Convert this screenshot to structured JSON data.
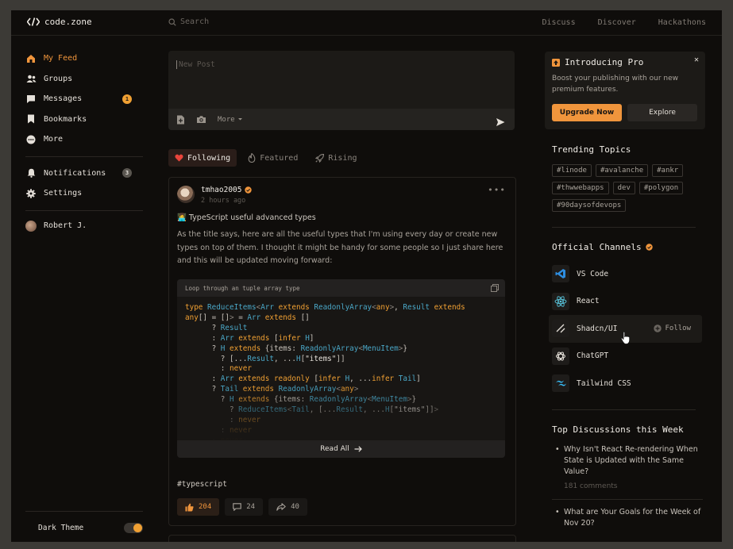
{
  "header": {
    "logo_text": "code.zone",
    "search_placeholder": "Search",
    "nav": [
      "Discuss",
      "Discover",
      "Hackathons"
    ]
  },
  "sidebar": {
    "items": [
      {
        "label": "My Feed",
        "icon": "home-icon",
        "active": true
      },
      {
        "label": "Groups",
        "icon": "groups-icon"
      },
      {
        "label": "Messages",
        "icon": "messages-icon",
        "badge": "1"
      },
      {
        "label": "Bookmarks",
        "icon": "bookmark-icon"
      },
      {
        "label": "More",
        "icon": "more-icon"
      }
    ],
    "secondary": [
      {
        "label": "Notifications",
        "icon": "bell-icon",
        "badge": "3"
      },
      {
        "label": "Settings",
        "icon": "gear-icon"
      }
    ],
    "profile_name": "Robert J.",
    "theme_label": "Dark Theme"
  },
  "composer": {
    "placeholder": "New Post",
    "more_label": "More"
  },
  "feed_tabs": [
    "Following",
    "Featured",
    "Rising"
  ],
  "post": {
    "author": "tmhao2005",
    "time": "2 hours ago",
    "title": "👩‍💻 TypeScript useful advanced types",
    "body": "As the title says, here are all the useful types that I'm using every day or create new types on top of them. I thought it might be handy for some people so I just share here and this will be updated moving forward:",
    "code_caption": "Loop through an tuple array type",
    "read_all": "Read All",
    "tag": "#typescript",
    "likes": "204",
    "comments": "24",
    "shares": "40"
  },
  "promo": {
    "title": "Introducing Pro",
    "description": "Boost your publishing with our new premium features.",
    "primary": "Upgrade Now",
    "secondary": "Explore"
  },
  "trending": {
    "title": "Trending Topics",
    "topics": [
      "#linode",
      "#avalanche",
      "#ankr",
      "#thwwebapps",
      "dev",
      "#polygon",
      "#90daysofdevops"
    ]
  },
  "channels": {
    "title": "Official Channels",
    "items": [
      {
        "name": "VS Code",
        "icon": "vscode-icon"
      },
      {
        "name": "React",
        "icon": "react-icon"
      },
      {
        "name": "Shadcn/UI",
        "icon": "shadcn-icon"
      },
      {
        "name": "ChatGPT",
        "icon": "chatgpt-icon"
      },
      {
        "name": "Tailwind CSS",
        "icon": "tailwind-icon"
      }
    ],
    "follow_label": "Follow"
  },
  "discussions": {
    "title": "Top Discussions this Week",
    "items": [
      {
        "title": "Why Isn't React Re-rendering When State is Updated with the Same Value?",
        "comments": "181 comments"
      },
      {
        "title": "What are Your Goals for the Week of Nov 20?",
        "comments": ""
      }
    ]
  },
  "colors": {
    "accent": "#f0953c",
    "background": "#0f0d0b",
    "type_blue": "#4aa7c7"
  }
}
